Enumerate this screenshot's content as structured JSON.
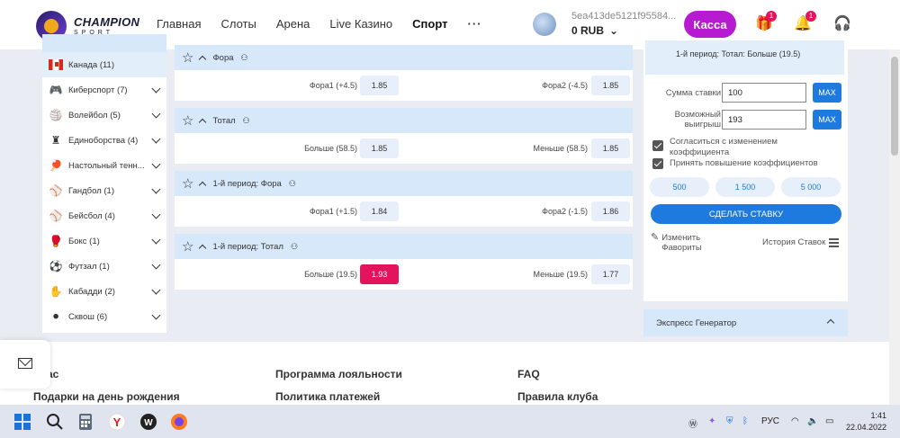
{
  "header": {
    "logo_title": "CHAMPION",
    "logo_sub": "SPORT",
    "nav": [
      "Главная",
      "Слоты",
      "Арена",
      "Live Казино",
      "Спорт"
    ],
    "nav_more": "···",
    "account_id": "5ea413de5121f95584...",
    "balance": "0 RUB",
    "kassa_label": "Касса",
    "gift_badge": "1",
    "bell_badge": "1"
  },
  "sidebar": {
    "items": [
      {
        "label": "Канада (11)",
        "icon": "canada-flag-icon",
        "selected": true
      },
      {
        "label": "Киберспорт (7)",
        "icon": "gamepad-icon"
      },
      {
        "label": "Волейбол (5)",
        "icon": "volleyball-icon"
      },
      {
        "label": "Единоборства (4)",
        "icon": "fight-icon"
      },
      {
        "label": "Настольный тенн...",
        "icon": "table-tennis-icon"
      },
      {
        "label": "Гандбол (1)",
        "icon": "handball-icon"
      },
      {
        "label": "Бейсбол (4)",
        "icon": "baseball-icon"
      },
      {
        "label": "Бокс (1)",
        "icon": "boxing-glove-icon"
      },
      {
        "label": "Футзал (1)",
        "icon": "futsal-ball-icon"
      },
      {
        "label": "Кабадди (2)",
        "icon": "kabaddi-icon"
      },
      {
        "label": "Сквош (6)",
        "icon": "squash-icon"
      }
    ]
  },
  "markets": [
    {
      "title": "Фора",
      "outcomes": [
        {
          "label": "Фора1 (+4.5)",
          "odd": "1.85"
        },
        {
          "label": "Фора2 (-4.5)",
          "odd": "1.85"
        }
      ]
    },
    {
      "title": "Тотал",
      "outcomes": [
        {
          "label": "Больше (58.5)",
          "odd": "1.85"
        },
        {
          "label": "Меньше (58.5)",
          "odd": "1.85"
        }
      ]
    },
    {
      "title": "1-й период: Фора",
      "outcomes": [
        {
          "label": "Фора1 (+1.5)",
          "odd": "1.84"
        },
        {
          "label": "Фора2 (-1.5)",
          "odd": "1.86"
        }
      ]
    },
    {
      "title": "1-й период: Тотал",
      "outcomes": [
        {
          "label": "Больше (19.5)",
          "odd": "1.93",
          "selected": true
        },
        {
          "label": "Меньше (19.5)",
          "odd": "1.77"
        }
      ]
    }
  ],
  "betslip": {
    "selection": "1-й период: Тотал: Больше (19.5)",
    "stake_label": "Сумма ставки",
    "stake_value": "100",
    "win_label": "Возможный выигрыш",
    "win_value": "193",
    "max_label": "MAX",
    "accept_changes": "Согласиться с изменением коэффициента",
    "accept_increase": "Принять повышение коэффициентов",
    "quick": [
      "500",
      "1 500",
      "5 000"
    ],
    "place_label": "СДЕЛАТЬ СТАВКУ",
    "edit_favorites": "Изменить Фавориты",
    "history_label": "История Ставок"
  },
  "express": {
    "label": "Экспресс Генератор"
  },
  "footer": {
    "col1": [
      "ас",
      "Подарки на день рождения"
    ],
    "col2": [
      "Программа лояльности",
      "Политика платежей"
    ],
    "col3": [
      "FAQ",
      "Правила клуба"
    ]
  },
  "taskbar": {
    "lang": "РУС",
    "time": "1:41",
    "date": "22.04.2022"
  },
  "colors": {
    "accent": "#1f7ae0",
    "kassa": "#b61ad1",
    "selected_odd": "#e3135e",
    "header_band": "#d6e8fa"
  }
}
